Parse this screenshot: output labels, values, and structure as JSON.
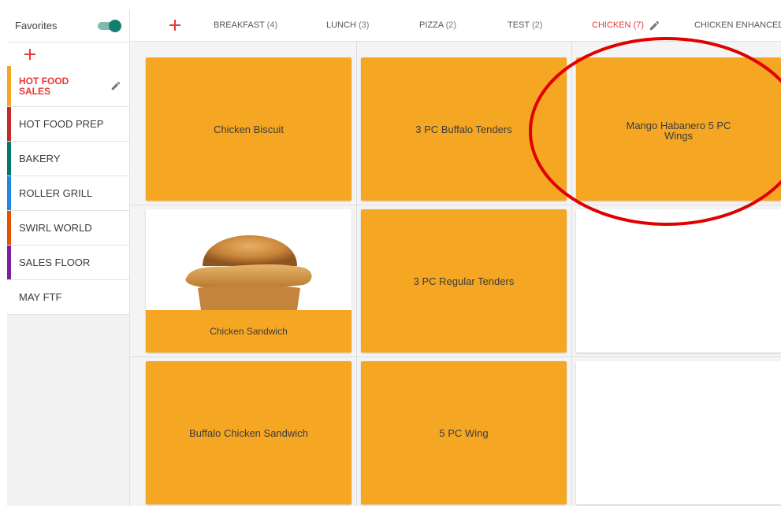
{
  "sidebar": {
    "favorites_label": "Favorites",
    "favorites_on": true,
    "items": [
      {
        "label": "HOT FOOD SALES",
        "color": "#f5a623",
        "active": true
      },
      {
        "label": "HOT FOOD PREP",
        "color": "#c62828"
      },
      {
        "label": "BAKERY",
        "color": "#00796b"
      },
      {
        "label": "ROLLER GRILL",
        "color": "#1e88e5"
      },
      {
        "label": "SWIRL WORLD",
        "color": "#e65100"
      },
      {
        "label": "SALES FLOOR",
        "color": "#7b1fa2"
      },
      {
        "label": "MAY FTF",
        "color": "#ffffff"
      }
    ]
  },
  "tabs": [
    {
      "label": "BREAKFAST",
      "count": "(4)"
    },
    {
      "label": "LUNCH",
      "count": "(3)"
    },
    {
      "label": "PIZZA",
      "count": "(2)"
    },
    {
      "label": "TEST",
      "count": "(2)"
    },
    {
      "label": "CHICKEN",
      "count": "(7)",
      "active": true
    },
    {
      "label": "CHICKEN ENHANCED",
      "count": ""
    }
  ],
  "tiles": [
    {
      "label": "Chicken Biscuit"
    },
    {
      "label": "3 PC Buffalo Tenders"
    },
    {
      "label": "Mango Habanero 5 PC Wings"
    },
    {
      "label": "Chicken Sandwich",
      "image": "chicken-sandwich-photo"
    },
    {
      "label": "3 PC Regular Tenders"
    },
    {
      "label": ""
    },
    {
      "label": "Buffalo Chicken Sandwich"
    },
    {
      "label": "5 PC Wing"
    },
    {
      "label": ""
    }
  ],
  "colors": {
    "accent": "#e53935",
    "tile": "#f5a623",
    "toggle": "#13806d",
    "annotation": "#e10000"
  },
  "icons": {
    "add": "plus-icon",
    "edit": "pencil-icon"
  }
}
